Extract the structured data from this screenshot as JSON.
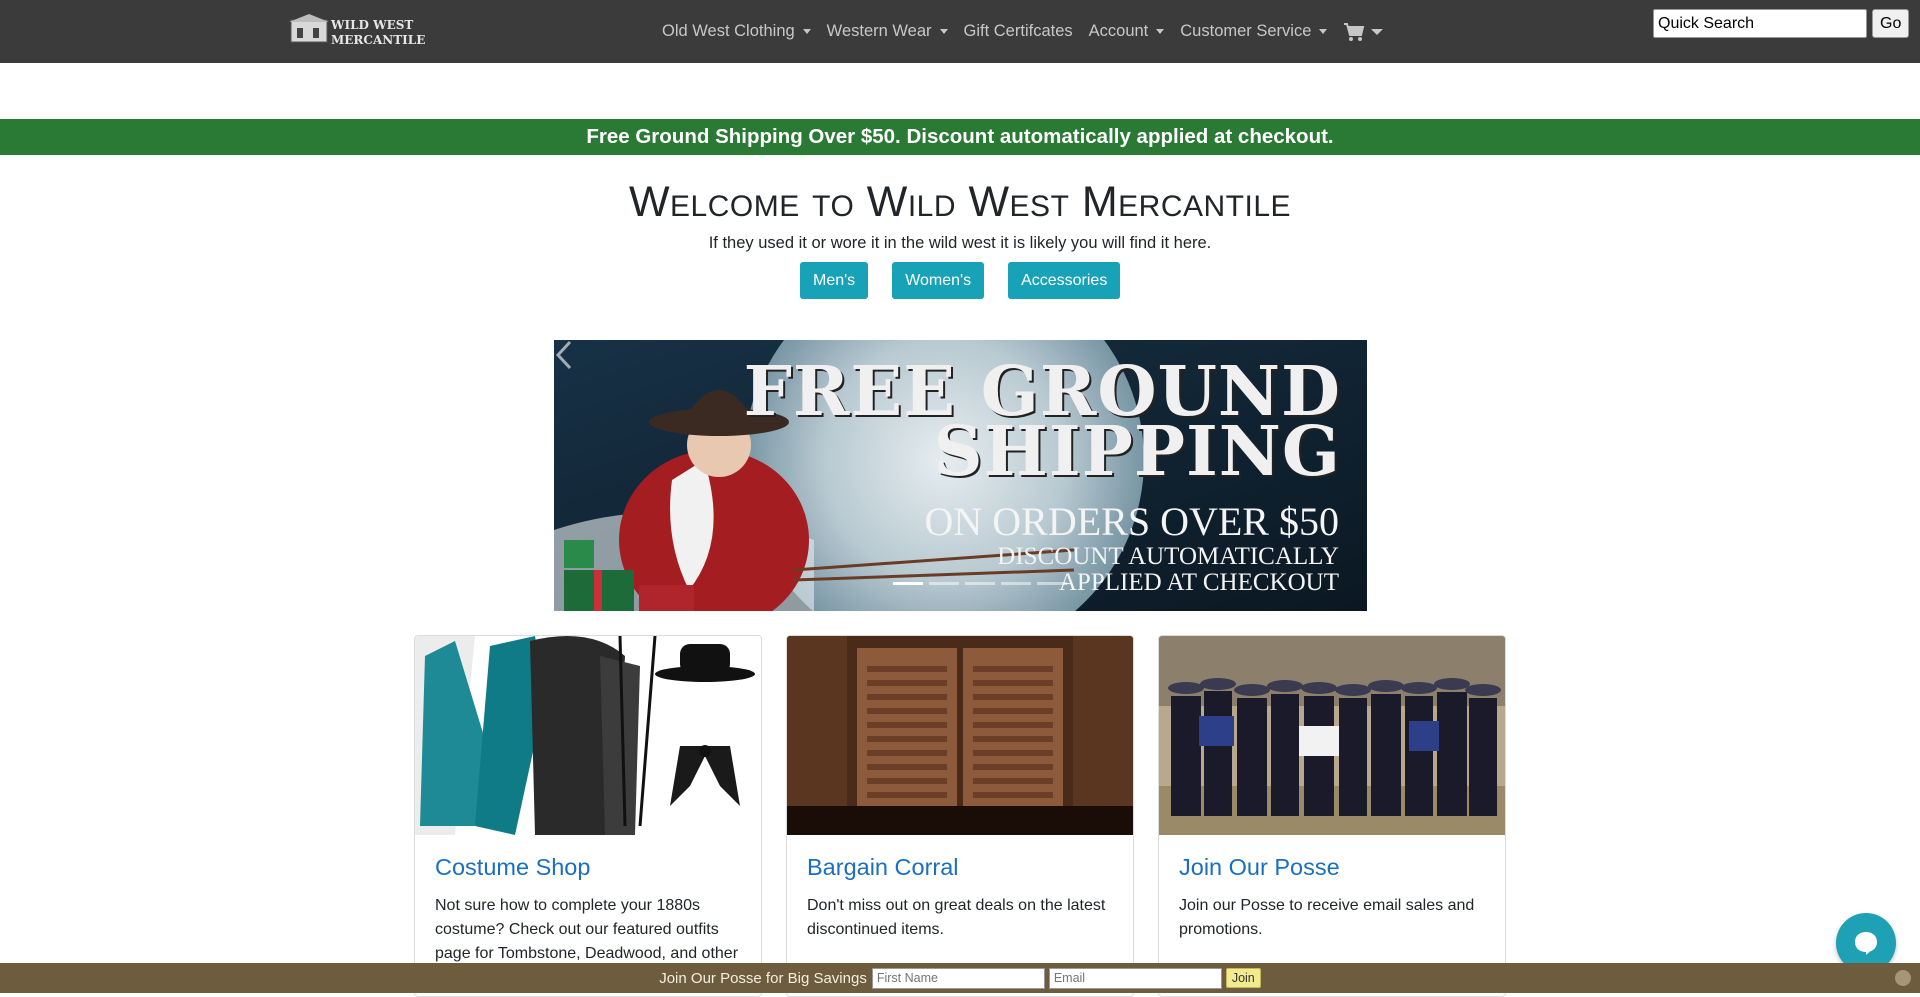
{
  "header": {
    "logo_text": "WILD WEST MERCANTILE",
    "nav": [
      {
        "label": "Old West Clothing",
        "dropdown": true
      },
      {
        "label": "Western Wear",
        "dropdown": true
      },
      {
        "label": "Gift Certifcates",
        "dropdown": false
      },
      {
        "label": "Account",
        "dropdown": true
      },
      {
        "label": "Customer Service",
        "dropdown": true
      }
    ],
    "cart_icon": "shopping-cart-icon",
    "search": {
      "value": "Quick Search",
      "button_label": "Go"
    }
  },
  "promo_bar": {
    "text": "Free Ground Shipping Over $50. Discount automatically applied at checkout."
  },
  "welcome": {
    "title": "Welcome to Wild West Mercantile",
    "subtitle": "If they used it or wore it in the wild west it is likely you will find it here.",
    "buttons": [
      "Men's",
      "Women's",
      "Accessories"
    ]
  },
  "carousel": {
    "line1": "FREE GROUND",
    "line2": "SHIPPING",
    "line3": "ON ORDERS OVER $50",
    "line4": "DISCOUNT AUTOMATICALLY",
    "line5": "APPLIED AT CHECKOUT",
    "indicator_count": 5,
    "active_indicator": 1
  },
  "cards": [
    {
      "title": "Costume Shop",
      "text": "Not sure how to complete your 1880s costume? Check out our featured outfits page for Tombstone, Deadwood, and other"
    },
    {
      "title": "Bargain Corral",
      "text": "Don't miss out on great deals on the latest discontinued items."
    },
    {
      "title": "Join Our Posse",
      "text": "Join our Posse to receive email sales and promotions."
    }
  ],
  "signup": {
    "label": "Join Our Posse for Big Savings",
    "first_name_placeholder": "First Name",
    "email_placeholder": "Email",
    "button_label": "Join"
  },
  "colors": {
    "navbar": "#3b3b3b",
    "promo_green": "#2a7a35",
    "button_teal": "#17a2b8",
    "card_title": "#1a6fbf",
    "signup_bar": "#6e5c3e",
    "chat": "#1fa1b5"
  }
}
